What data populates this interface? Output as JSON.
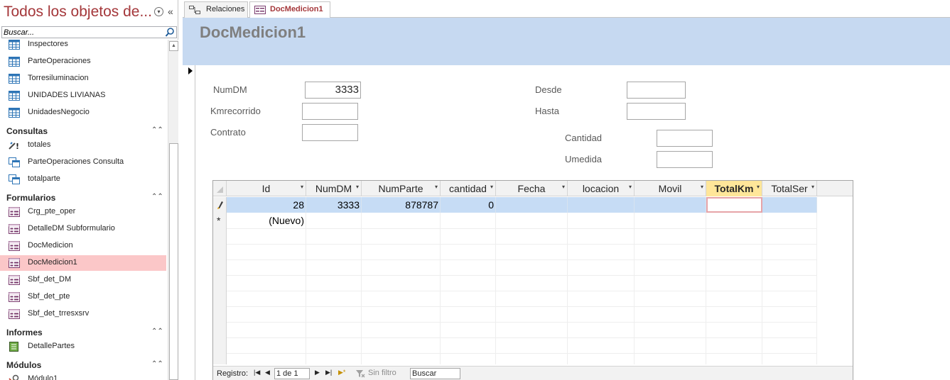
{
  "nav": {
    "title": "Todos los objetos de...",
    "search_placeholder": "Buscar...",
    "entries": [
      {
        "kind": "item",
        "icon": "table-icon",
        "label": "Inspectores"
      },
      {
        "kind": "item",
        "icon": "table-icon",
        "label": "ParteOperaciones"
      },
      {
        "kind": "item",
        "icon": "table-icon",
        "label": "Torresiluminacion"
      },
      {
        "kind": "item",
        "icon": "table-icon",
        "label": "UNIDADES LIVIANAS"
      },
      {
        "kind": "item",
        "icon": "table-icon",
        "label": "UnidadesNegocio"
      },
      {
        "kind": "group",
        "label": "Consultas"
      },
      {
        "kind": "item",
        "icon": "totals-query-icon",
        "label": "totales"
      },
      {
        "kind": "item",
        "icon": "query-icon",
        "label": "ParteOperaciones Consulta"
      },
      {
        "kind": "item",
        "icon": "query-icon",
        "label": "totalparte"
      },
      {
        "kind": "group",
        "label": "Formularios"
      },
      {
        "kind": "item",
        "icon": "form-icon",
        "label": "Crg_pte_oper"
      },
      {
        "kind": "item",
        "icon": "form-icon",
        "label": "DetalleDM Subformulario"
      },
      {
        "kind": "item",
        "icon": "form-icon",
        "label": "DocMedicion"
      },
      {
        "kind": "item",
        "icon": "form-icon",
        "label": "DocMedicion1",
        "selected": true
      },
      {
        "kind": "item",
        "icon": "form-icon",
        "label": "Sbf_det_DM"
      },
      {
        "kind": "item",
        "icon": "form-icon",
        "label": "Sbf_det_pte"
      },
      {
        "kind": "item",
        "icon": "form-icon",
        "label": "Sbf_det_trresxsrv"
      },
      {
        "kind": "group",
        "label": "Informes"
      },
      {
        "kind": "item",
        "icon": "report-icon",
        "label": "DetallePartes"
      },
      {
        "kind": "group",
        "label": "Módulos"
      },
      {
        "kind": "item",
        "icon": "module-icon",
        "label": "Módulo1"
      }
    ]
  },
  "tabs": [
    {
      "label": "Relaciones",
      "icon": "relationships-icon",
      "active": false
    },
    {
      "label": "DocMedicion1",
      "icon": "form-icon",
      "active": true
    }
  ],
  "form": {
    "title": "DocMedicion1",
    "fields": {
      "numdm": {
        "label": "NumDM",
        "value": "3333"
      },
      "kmrecorrido": {
        "label": "Kmrecorrido",
        "value": ""
      },
      "contrato": {
        "label": "Contrato",
        "value": ""
      },
      "desde": {
        "label": "Desde",
        "value": ""
      },
      "hasta": {
        "label": "Hasta",
        "value": ""
      },
      "cantidad": {
        "label": "Cantidad",
        "value": ""
      },
      "umedida": {
        "label": "Umedida",
        "value": ""
      }
    }
  },
  "datasheet": {
    "columns": [
      "Id",
      "NumDM",
      "NumParte",
      "cantidad",
      "Fecha",
      "locacion",
      "Movil",
      "TotalKm",
      "TotalSer"
    ],
    "active_column": "TotalKm",
    "row": [
      "28",
      "3333",
      "878787",
      "0",
      "",
      "",
      "",
      "",
      ""
    ],
    "new_row_label": "(Nuevo)",
    "nav": {
      "record_label": "Registro:",
      "position": "1 de 1",
      "filter_label": "Sin filtro",
      "search_value": "Buscar"
    }
  }
}
